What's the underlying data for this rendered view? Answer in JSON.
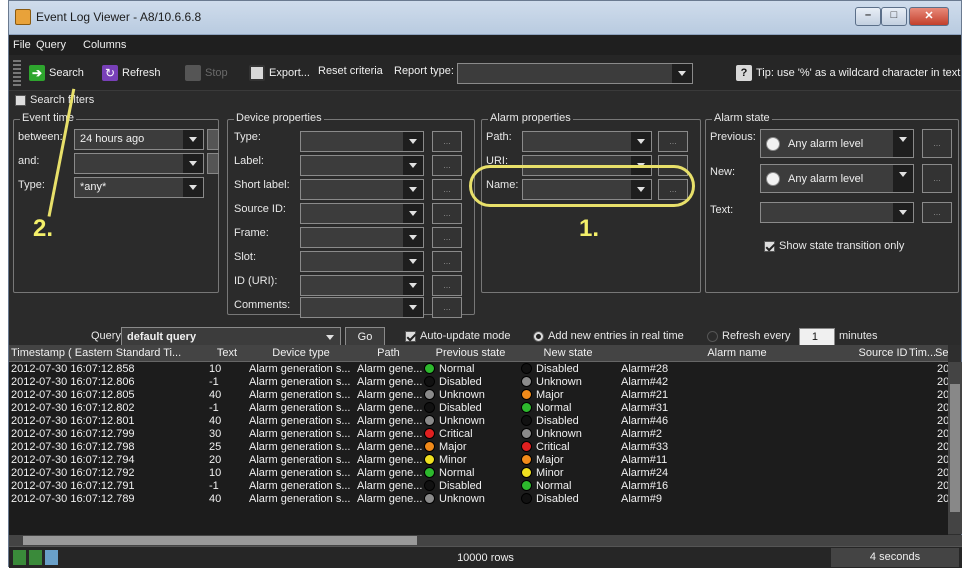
{
  "window": {
    "title": "Event Log Viewer - A8/10.6.6.8"
  },
  "menu": [
    "File",
    "Query",
    "Columns"
  ],
  "toolbar": {
    "search": "Search",
    "refresh": "Refresh",
    "stop": "Stop",
    "export": "Export...",
    "reset": "Reset criteria",
    "report_type": "Report type:",
    "report_value": "",
    "tip": "Tip: use '%' as a wildcard character in text"
  },
  "filters": {
    "toggle": "Search filters",
    "event_time": {
      "legend": "Event time",
      "between_label": "between:",
      "between_value": "24 hours ago",
      "and_label": "and:",
      "and_value": "",
      "type_label": "Type:",
      "type_value": "*any*"
    },
    "device": {
      "legend": "Device properties",
      "fields": [
        "Type:",
        "Label:",
        "Short label:",
        "Source ID:",
        "Frame:",
        "Slot:",
        "ID (URI):",
        "Comments:"
      ]
    },
    "alarm": {
      "legend": "Alarm properties",
      "fields": [
        "Path:",
        "URI:",
        "Name:"
      ]
    },
    "state": {
      "legend": "Alarm state",
      "previous_label": "Previous:",
      "previous_value": "Any alarm level",
      "new_label": "New:",
      "new_value": "Any alarm level",
      "text_label": "Text:",
      "transition_only": "Show state transition only"
    },
    "ellipsis": "..."
  },
  "query": {
    "label": "Query:",
    "value": "default query",
    "go": "Go",
    "auto_update": "Auto-update mode",
    "add_new": "Add new entries in real time",
    "refresh_every": "Refresh every",
    "refresh_value": "1",
    "minutes": "minutes"
  },
  "annotations": {
    "one": "1.",
    "two": "2."
  },
  "table": {
    "headers": [
      "Timestamp ( Eastern Standard Ti...",
      "Text",
      "Device type",
      "Path",
      "Previous state",
      "New state",
      "Alarm name",
      "Source ID",
      "Tim...",
      "Se"
    ],
    "rows": [
      [
        "2012-07-30 16:07:12.858",
        "10",
        "Alarm generation s...",
        "Alarm gene...",
        "Normal",
        "Disabled",
        "Alarm#28",
        "20"
      ],
      [
        "2012-07-30 16:07:12.806",
        "-1",
        "Alarm generation s...",
        "Alarm gene...",
        "Disabled",
        "Unknown",
        "Alarm#42",
        "20"
      ],
      [
        "2012-07-30 16:07:12.805",
        "40",
        "Alarm generation s...",
        "Alarm gene...",
        "Unknown",
        "Major",
        "Alarm#21",
        "20"
      ],
      [
        "2012-07-30 16:07:12.802",
        "-1",
        "Alarm generation s...",
        "Alarm gene...",
        "Disabled",
        "Normal",
        "Alarm#31",
        "20"
      ],
      [
        "2012-07-30 16:07:12.801",
        "40",
        "Alarm generation s...",
        "Alarm gene...",
        "Unknown",
        "Disabled",
        "Alarm#46",
        "20"
      ],
      [
        "2012-07-30 16:07:12.799",
        "30",
        "Alarm generation s...",
        "Alarm gene...",
        "Critical",
        "Unknown",
        "Alarm#2",
        "20"
      ],
      [
        "2012-07-30 16:07:12.798",
        "25",
        "Alarm generation s...",
        "Alarm gene...",
        "Major",
        "Critical",
        "Alarm#33",
        "20"
      ],
      [
        "2012-07-30 16:07:12.794",
        "20",
        "Alarm generation s...",
        "Alarm gene...",
        "Minor",
        "Major",
        "Alarm#11",
        "20"
      ],
      [
        "2012-07-30 16:07:12.792",
        "10",
        "Alarm generation s...",
        "Alarm gene...",
        "Normal",
        "Minor",
        "Alarm#24",
        "20"
      ],
      [
        "2012-07-30 16:07:12.791",
        "-1",
        "Alarm generation s...",
        "Alarm gene...",
        "Disabled",
        "Normal",
        "Alarm#16",
        "20"
      ],
      [
        "2012-07-30 16:07:12.789",
        "40",
        "Alarm generation s...",
        "Alarm gene...",
        "Unknown",
        "Disabled",
        "Alarm#9",
        "20"
      ]
    ],
    "state_colors": {
      "Normal": "#2db82d",
      "Disabled": "#111111",
      "Unknown": "#8a8a8a",
      "Major": "#f08a1a",
      "Critical": "#e02020",
      "Minor": "#f0e020"
    }
  },
  "status": {
    "rows": "10000 rows",
    "time": "4 seconds"
  }
}
